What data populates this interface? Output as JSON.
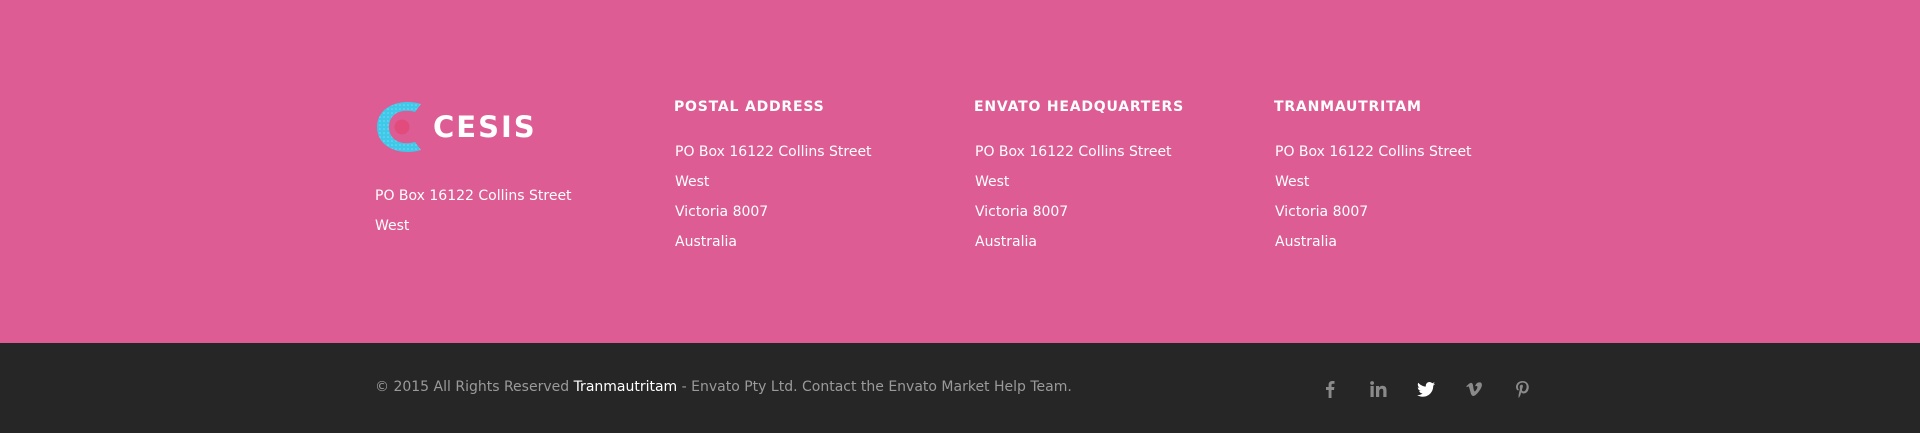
{
  "brand": {
    "name": "CESIS",
    "colors": {
      "footer_bg": "#dd5c94",
      "bottom_bg": "#262626",
      "logo_accent": "#3fc8e8"
    }
  },
  "columns": [
    {
      "kind": "logo",
      "lines": [
        "PO Box 16122 Collins Street",
        "West"
      ]
    },
    {
      "title": "POSTAL ADDRESS",
      "lines": [
        "PO Box 16122 Collins Street",
        "West",
        "Victoria 8007",
        "Australia"
      ]
    },
    {
      "title": "ENVATO HEADQUARTERS",
      "lines": [
        "PO Box 16122 Collins Street",
        "West",
        "Victoria 8007",
        "Australia"
      ]
    },
    {
      "title": "TRANMAUTRITAM",
      "lines": [
        "PO Box 16122 Collins Street",
        "West",
        "Victoria 8007",
        "Australia"
      ]
    }
  ],
  "bottom": {
    "copyright_prefix": "© 2015 All Rights Reserved ",
    "copyright_brand": "Tranmautritam",
    "copyright_suffix": " - Envato Pty Ltd. Contact the Envato Market Help Team.",
    "social": [
      {
        "icon": "facebook-icon"
      },
      {
        "icon": "linkedin-icon"
      },
      {
        "icon": "twitter-icon"
      },
      {
        "icon": "vimeo-icon"
      },
      {
        "icon": "pinterest-icon"
      }
    ]
  }
}
